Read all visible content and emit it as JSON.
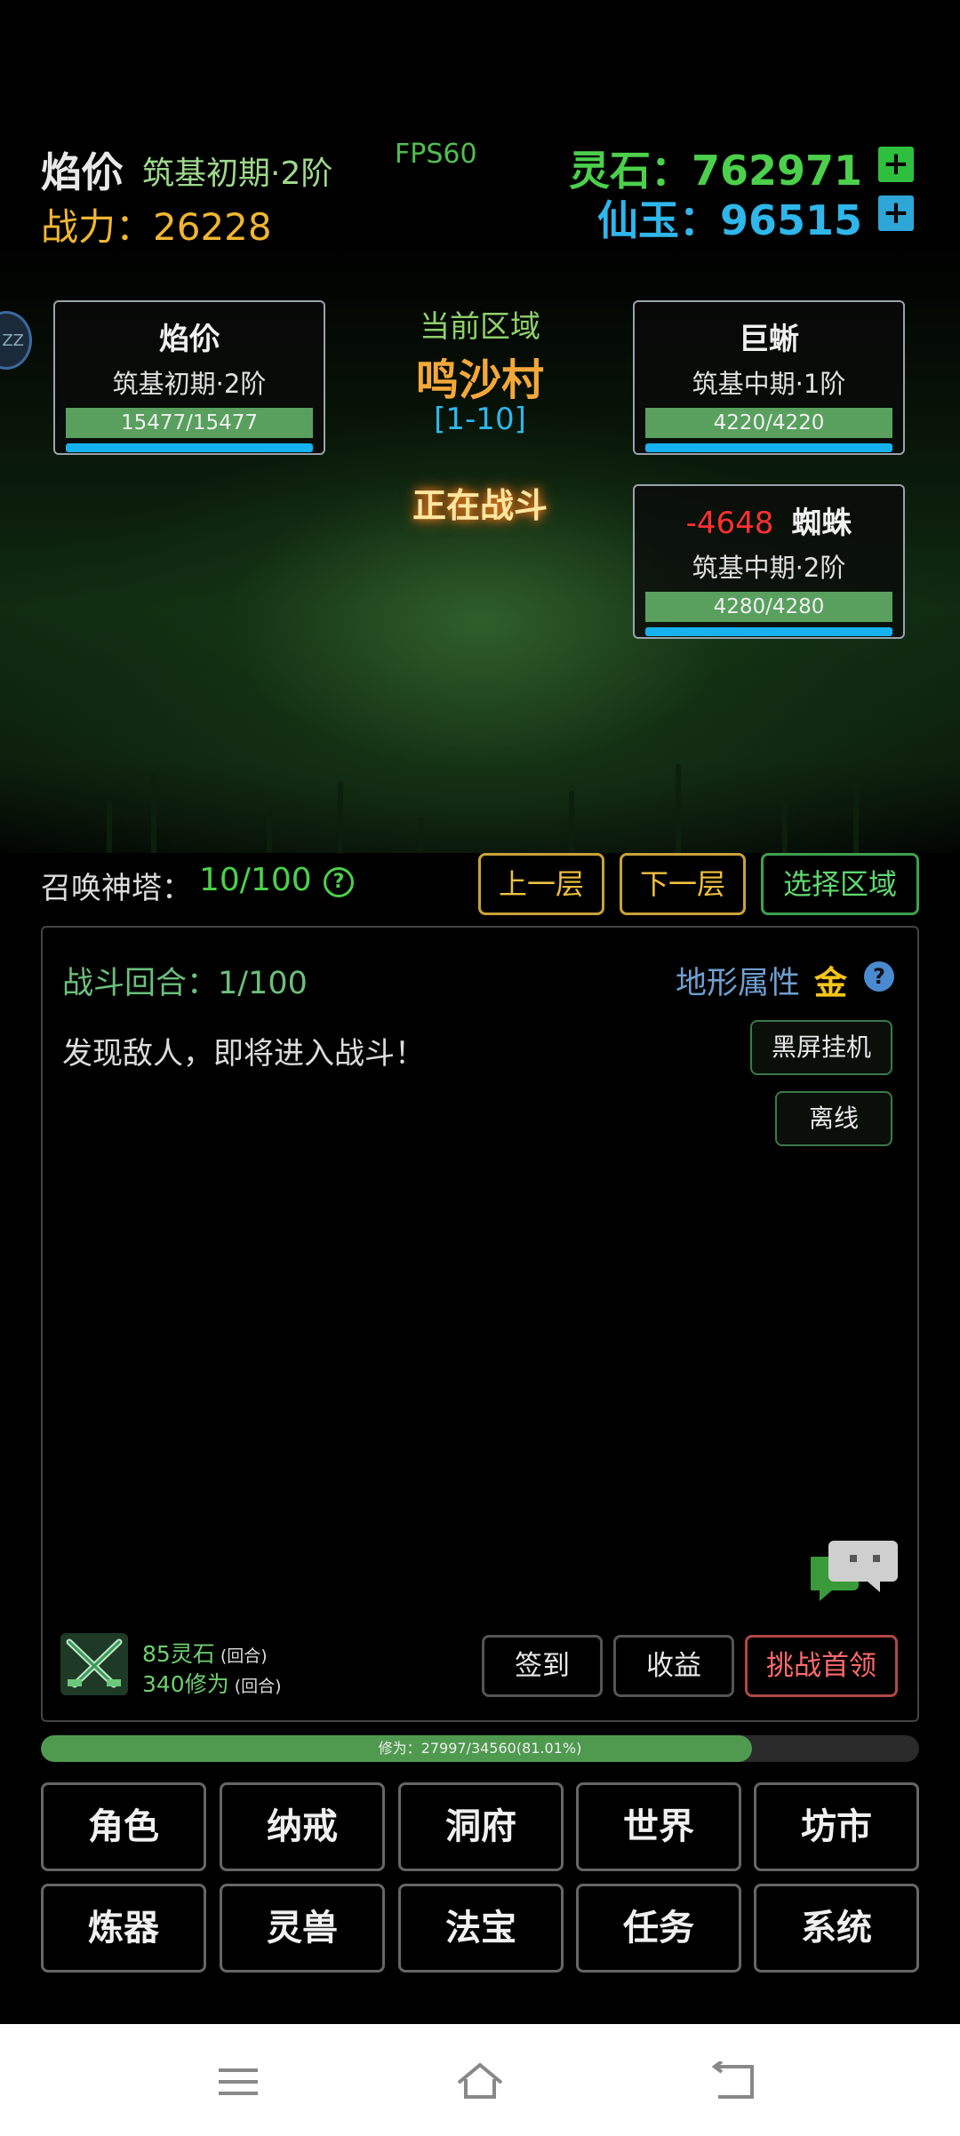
{
  "header": {
    "player_name": "焰伱",
    "player_realm": "筑基初期·2阶",
    "fps": "FPS60",
    "power_label": "战力：26228",
    "spirit_stone": "灵石：762971",
    "jade": "仙玉：96515",
    "plus": "+"
  },
  "side_orb": "ZZ",
  "player_card": {
    "name": "焰伱",
    "realm": "筑基初期·2阶",
    "hp": "15477/15477",
    "hp_fraction": 1.0,
    "mp_fraction": 1.0
  },
  "area": {
    "label": "当前区域",
    "name": "鸣沙村",
    "range": "[1-10]",
    "status": "正在战斗"
  },
  "enemies": [
    {
      "name": "巨蜥",
      "realm": "筑基中期·1阶",
      "hp": "4220/4220",
      "hp_fraction": 1.0,
      "mp_fraction": 1.0
    },
    {
      "damage": "-4648",
      "name": "蜘蛛",
      "realm": "筑基中期·2阶",
      "hp": "4280/4280",
      "hp_fraction": 1.0,
      "mp_fraction": 1.0
    }
  ],
  "tower": {
    "label": "召唤神塔：",
    "value": "10/100",
    "help": "?",
    "prev": "上一层",
    "next": "下一层",
    "select": "选择区域"
  },
  "battle": {
    "round": "战斗回合：1/100",
    "terrain_label": "地形属性",
    "terrain_value": "金",
    "terrain_help": "?",
    "log": "发现敌人，即将进入战斗！",
    "blackscreen": "黑屏挂机",
    "offline": "离线"
  },
  "rewards": {
    "stones": "85灵石",
    "exp": "340修为",
    "per_round": "(回合)"
  },
  "actions": {
    "checkin": "签到",
    "income": "收益",
    "boss": "挑战首领"
  },
  "exp_bar": {
    "text": "修为：27997/34560(81.01%)",
    "fraction": 0.8101
  },
  "menu": [
    "角色",
    "纳戒",
    "洞府",
    "世界",
    "坊市",
    "炼器",
    "灵兽",
    "法宝",
    "任务",
    "系统"
  ],
  "colors": {
    "spirit_green": "#4cd04c",
    "jade_blue": "#2fb6ea",
    "gold": "#f0b633",
    "hp_green": "#59a05f",
    "mp_blue": "#16b2f0"
  }
}
